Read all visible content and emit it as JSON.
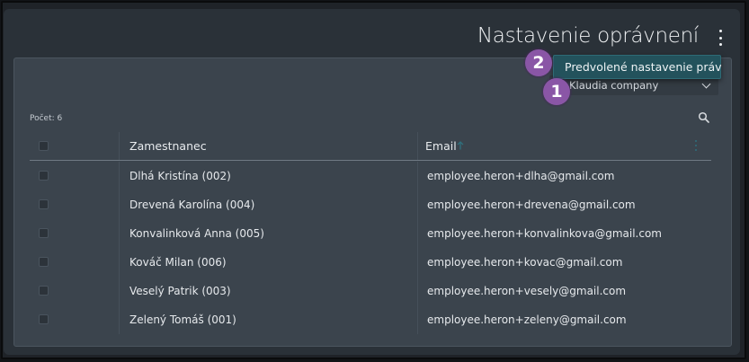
{
  "page": {
    "title": "Nastavenie oprávnení"
  },
  "menu": {
    "item": "Predvolené nastavenie práv"
  },
  "company_select": {
    "value": "Klaudia company"
  },
  "badges": {
    "first": "1",
    "second": "2"
  },
  "grid": {
    "count_label": "Počet: 6",
    "columns": [
      "Zamestnanec",
      "Email"
    ],
    "rows": [
      {
        "name": "Dlhá Kristína (002)",
        "email": "employee.heron+dlha@gmail.com"
      },
      {
        "name": "Drevená Karolína (004)",
        "email": "employee.heron+drevena@gmail.com"
      },
      {
        "name": "Konvalinková Anna (005)",
        "email": "employee.heron+konvalinkova@gmail.com"
      },
      {
        "name": "Kováč Milan (006)",
        "email": "employee.heron+kovac@gmail.com"
      },
      {
        "name": "Veselý Patrik (003)",
        "email": "employee.heron+vesely@gmail.com"
      },
      {
        "name": "Zelený Tomáš (001)",
        "email": "employee.heron+zeleny@gmail.com"
      }
    ]
  },
  "colors": {
    "accent": "#2f6f7c",
    "menu_bg": "#23525c",
    "badge": "#8a56a6"
  },
  "icons": {
    "kebab": "more-vertical-icon",
    "search": "search-icon",
    "sort": "arrow-up-icon",
    "select": "chevron-down-icon"
  }
}
